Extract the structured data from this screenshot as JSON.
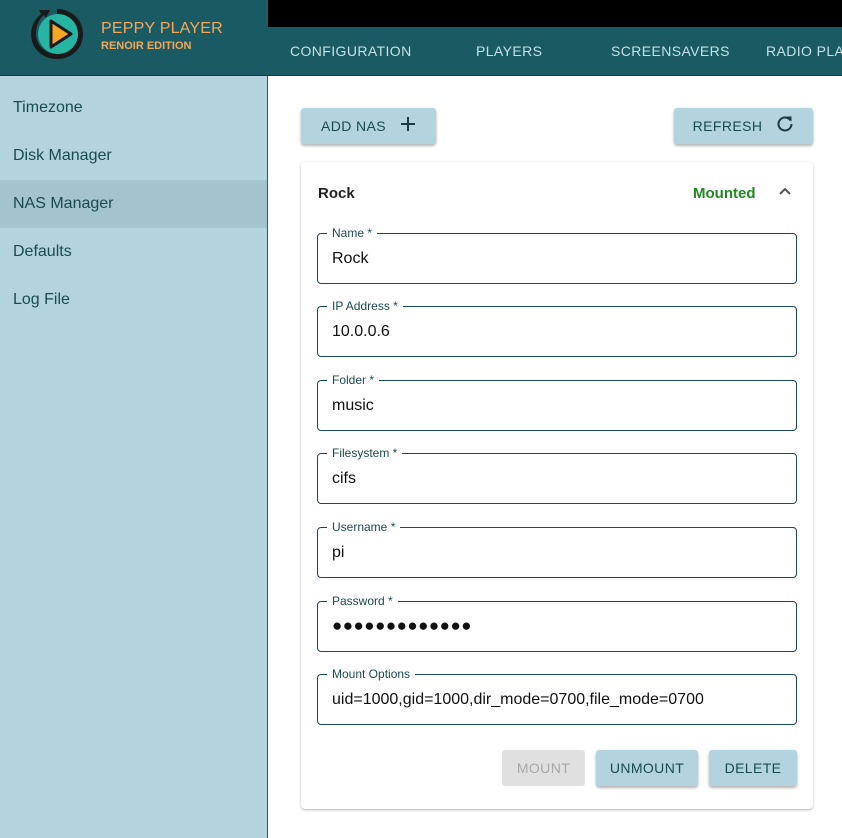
{
  "app": {
    "title": "PEPPY PLAYER",
    "subtitle": "RENOIR EDITION",
    "logo_icon": "play-logo-icon"
  },
  "tabs": [
    {
      "label": "CONFIGURATION"
    },
    {
      "label": "PLAYERS"
    },
    {
      "label": "SCREENSAVERS"
    },
    {
      "label": "RADIO PLA"
    }
  ],
  "sidebar": {
    "items": [
      {
        "label": "Timezone",
        "active": false
      },
      {
        "label": "Disk Manager",
        "active": false
      },
      {
        "label": "NAS Manager",
        "active": true
      },
      {
        "label": "Defaults",
        "active": false
      },
      {
        "label": "Log File",
        "active": false
      }
    ]
  },
  "toolbar": {
    "add_label": "ADD NAS",
    "add_icon": "plus-icon",
    "refresh_label": "REFRESH",
    "refresh_icon": "refresh-icon"
  },
  "nas": {
    "name": "Rock",
    "status": "Mounted",
    "status_color": "#1f8a1f",
    "fields": [
      {
        "label": "Name *",
        "value": "Rock"
      },
      {
        "label": "IP Address *",
        "value": "10.0.0.6"
      },
      {
        "label": "Folder *",
        "value": "music"
      },
      {
        "label": "Filesystem *",
        "value": "cifs"
      },
      {
        "label": "Username *",
        "value": "pi"
      },
      {
        "label": "Password *",
        "value": "●●●●●●●●●●●●●"
      },
      {
        "label": "Mount Options",
        "value": "uid=1000,gid=1000,dir_mode=0700,file_mode=0700"
      }
    ],
    "actions": {
      "mount_label": "MOUNT",
      "unmount_label": "UNMOUNT",
      "delete_label": "DELETE"
    }
  },
  "colors": {
    "header_bg": "#1a5a63",
    "accent": "#f6a85a",
    "sidebar_bg": "#b3d4df",
    "button_bg": "#b3d4df"
  }
}
